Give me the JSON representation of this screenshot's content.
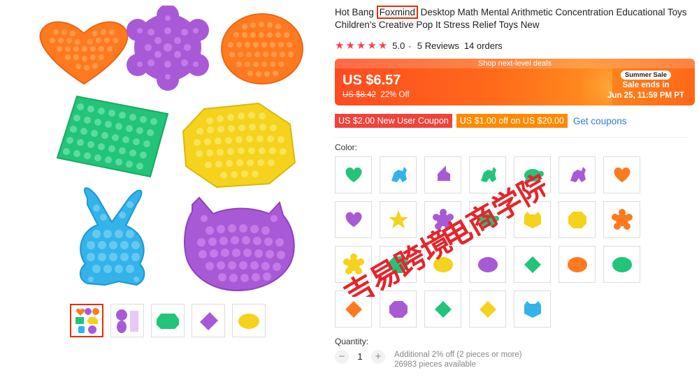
{
  "product": {
    "title_prefix": "Hot Bang ",
    "brand": "Foxmind",
    "title_suffix": " Desktop Math Mental Arithmetic Concentration Educational Toys Children's Creative Pop It Stress Relief Toys New",
    "rating_value": "5.0",
    "rating_stars": 5,
    "reviews": "5 Reviews",
    "orders": "14 orders"
  },
  "deal": {
    "strip": "Shop next-level deals",
    "price": "US $6.57",
    "original_price": "US $8.42",
    "discount": "22% Off",
    "badge": "Summer Sale",
    "ends_label": "Sale ends in",
    "ends_date": "Jun 25, 11:59 PM PT"
  },
  "coupons": {
    "new_user": "US $2.00 New User Coupon",
    "store": "US $1.00 off on US $20.00",
    "get": "Get coupons"
  },
  "color_label": "Color:",
  "color_options": [
    "green heart",
    "blue dinosaur",
    "purple unicorn",
    "green dinosaur",
    "green turtle",
    "purple dinosaur",
    "orange heart",
    "purple heart",
    "yellow star",
    "purple flower",
    "green turtle",
    "yellow cat",
    "yellow octagon",
    "orange flower",
    "yellow flower",
    "green octagon",
    "yellow round",
    "purple round",
    "green square",
    "orange round",
    "green round",
    "orange square",
    "purple octagon",
    "green square",
    "yellow square",
    "blue cat"
  ],
  "quantity": {
    "label": "Quantity:",
    "value": "1",
    "discount_note": "Additional 2% off (2 pieces or more)",
    "available": "26983 pieces available"
  },
  "watermark": {
    "line1": "吉易跨境",
    "line2": "电商学院"
  },
  "colors": {
    "accent": "#e62e04",
    "star": "#f0464d",
    "link": "#2e7cde",
    "orange": "#ff7a1f",
    "purple": "#a85ad6",
    "green": "#22c47a",
    "yellow": "#f5d21c",
    "blue": "#33b3ea"
  }
}
